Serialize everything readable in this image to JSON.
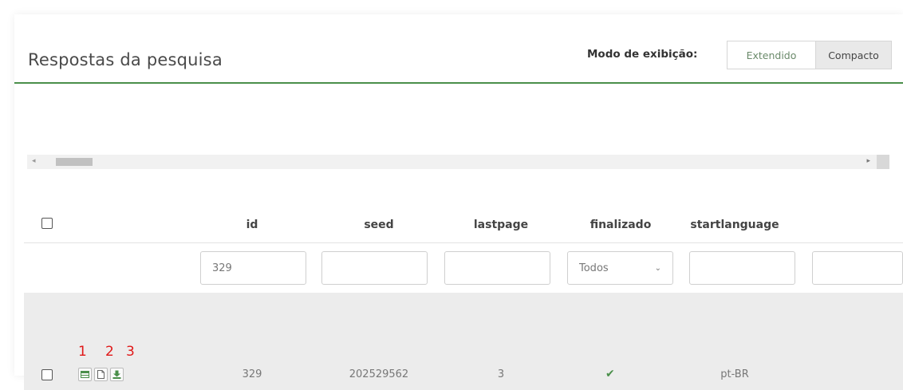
{
  "header": {
    "title": "Respostas da pesquisa",
    "view_mode_label": "Modo de exibição:",
    "view_modes": [
      "Extendido",
      "Compacto"
    ],
    "active_view_mode": "Compacto"
  },
  "table": {
    "columns": [
      "id",
      "seed",
      "lastpage",
      "finalizado",
      "startlanguage"
    ],
    "filters": {
      "id": "329",
      "seed": "",
      "lastpage": "",
      "finalizado": "Todos",
      "startlanguage": "",
      "next": ""
    },
    "rows": [
      {
        "annotations": [
          "1",
          "2",
          "3"
        ],
        "action_icons": [
          "view-table-icon",
          "document-icon",
          "download-icon"
        ],
        "id": "329",
        "seed": "202529562",
        "lastpage": "3",
        "finalizado": "check-icon",
        "startlanguage": "pt-BR"
      }
    ]
  },
  "colors": {
    "accent_green": "#4a8f4a",
    "annotation_red": "#e01818",
    "row_background": "#ececec"
  }
}
